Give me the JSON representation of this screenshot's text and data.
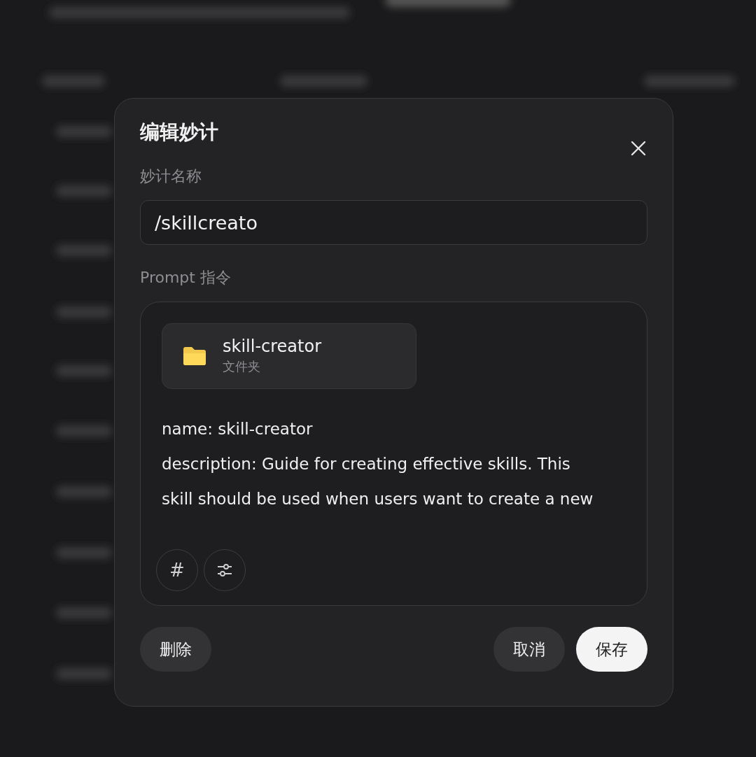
{
  "dialog": {
    "title": "编辑妙计",
    "name_field": {
      "label": "妙计名称",
      "value": "/skillcreato"
    },
    "prompt": {
      "label": "Prompt 指令",
      "attachment": {
        "name": "skill-creator",
        "type": "文件夹"
      },
      "lines": [
        "name: skill-creator",
        "description: Guide for creating effective skills. This",
        "skill should be used when users want to create a new"
      ],
      "tools": [
        {
          "kind": "hash",
          "label": "#"
        },
        {
          "kind": "sliders"
        }
      ]
    },
    "footer": {
      "left": [
        {
          "label": "删除",
          "kind": "secondary"
        }
      ],
      "right": [
        {
          "label": "取消",
          "kind": "secondary"
        },
        {
          "label": "保存",
          "kind": "primary"
        }
      ]
    }
  }
}
